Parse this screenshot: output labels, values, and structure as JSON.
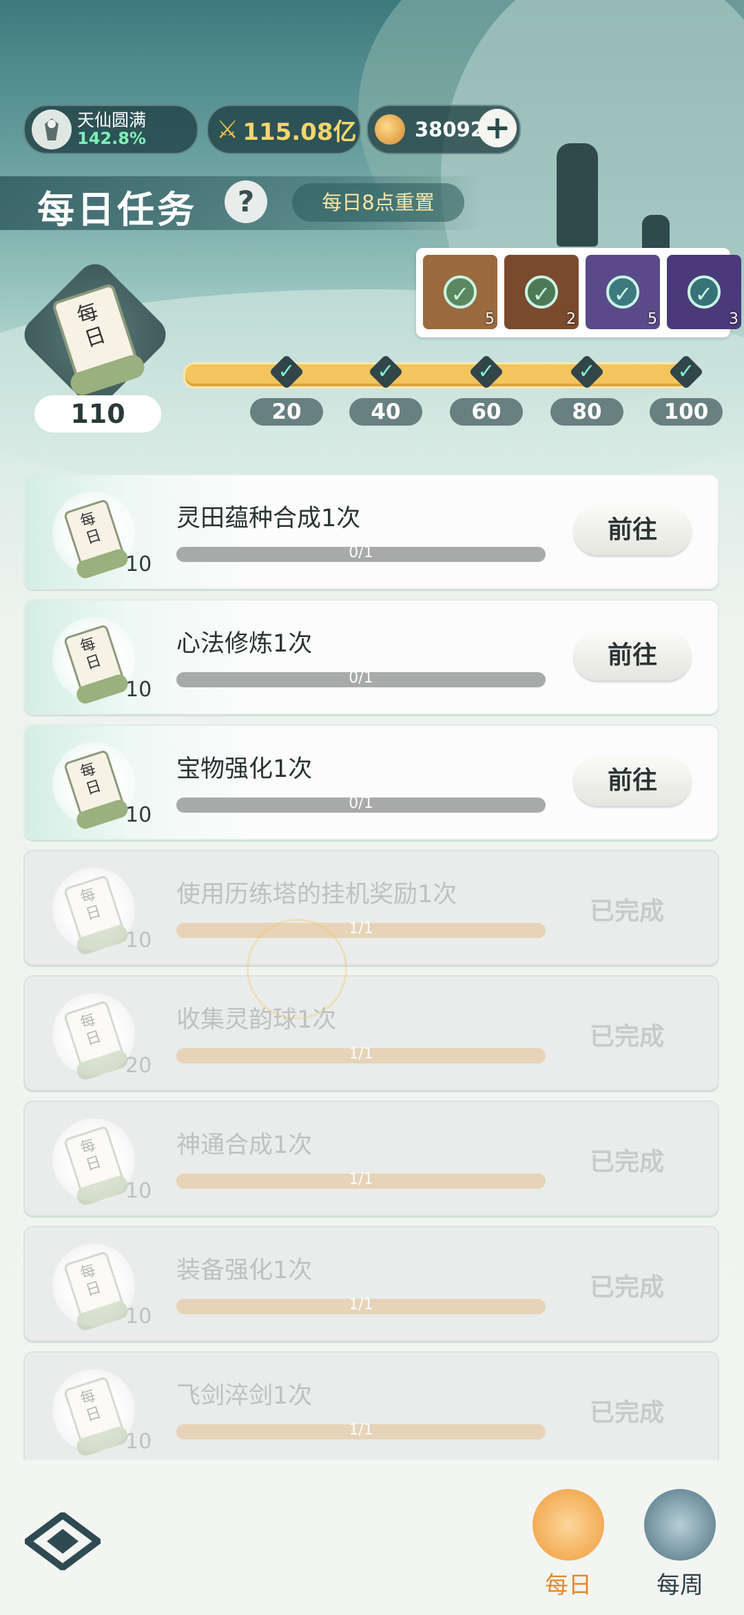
{
  "player": {
    "rank_name": "天仙圆满",
    "rank_percent": "142.8%",
    "power": "115.08亿",
    "currency": "38092"
  },
  "header": {
    "title": "每日任务",
    "help_label": "?",
    "reset_label": "每日8点重置"
  },
  "progress": {
    "current_points": "110",
    "badge_text": "每日",
    "milestones": [
      "20",
      "40",
      "60",
      "80",
      "100"
    ],
    "fill_fraction": 1.0,
    "rewards": [
      {
        "count": "5",
        "claimed": true,
        "color": "#9a6a3e"
      },
      {
        "count": "2",
        "claimed": true,
        "color": "#7a4a2e"
      },
      {
        "count": "5",
        "claimed": true,
        "color": "#5a4a8a"
      },
      {
        "count": "3",
        "claimed": true,
        "color": "#4a3a7a"
      }
    ]
  },
  "tasks": [
    {
      "name": "灵田蕴种合成1次",
      "points": "10",
      "progress": "0/1",
      "fraction": 0,
      "status": "active",
      "action": "前往"
    },
    {
      "name": "心法修炼1次",
      "points": "10",
      "progress": "0/1",
      "fraction": 0,
      "status": "active",
      "action": "前往"
    },
    {
      "name": "宝物强化1次",
      "points": "10",
      "progress": "0/1",
      "fraction": 0,
      "status": "active",
      "action": "前往"
    },
    {
      "name": "使用历练塔的挂机奖励1次",
      "points": "10",
      "progress": "1/1",
      "fraction": 1,
      "status": "done",
      "action": "已完成"
    },
    {
      "name": "收集灵韵球1次",
      "points": "20",
      "progress": "1/1",
      "fraction": 1,
      "status": "done",
      "action": "已完成"
    },
    {
      "name": "神通合成1次",
      "points": "10",
      "progress": "1/1",
      "fraction": 1,
      "status": "done",
      "action": "已完成"
    },
    {
      "name": "装备强化1次",
      "points": "10",
      "progress": "1/1",
      "fraction": 1,
      "status": "done",
      "action": "已完成"
    },
    {
      "name": "飞剑淬剑1次",
      "points": "10",
      "progress": "1/1",
      "fraction": 1,
      "status": "done",
      "action": "已完成"
    }
  ],
  "scroll_text": "每日",
  "bottom_tabs": {
    "daily": "每日",
    "weekly": "每周"
  },
  "colors": {
    "accent_orange": "#f09a3a",
    "progress_gold": "#f2c55d",
    "check_mint": "#7ef0cf"
  }
}
